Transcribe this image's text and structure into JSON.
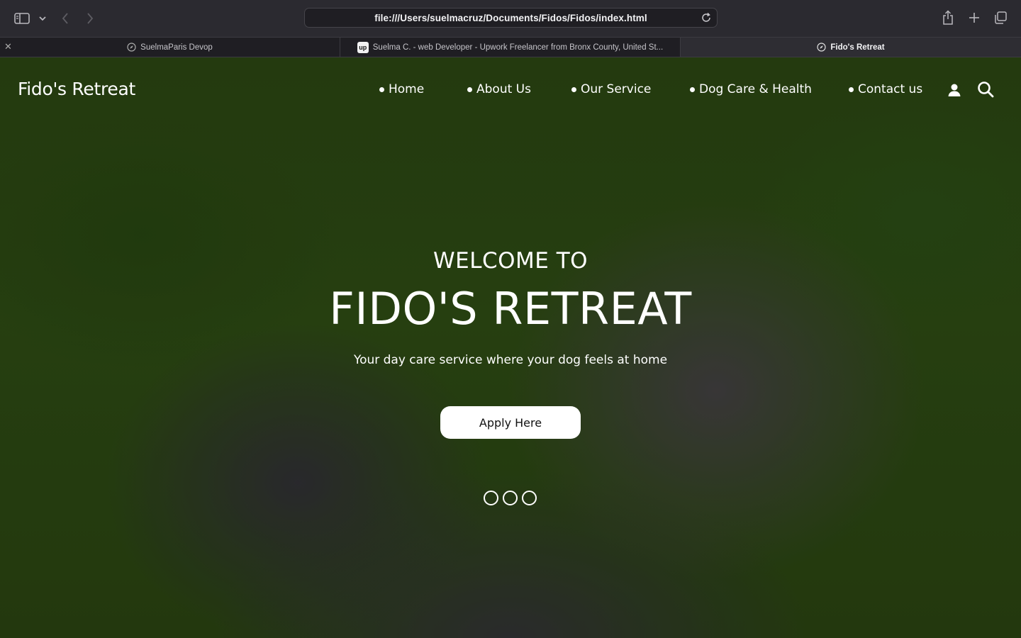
{
  "browser": {
    "address": "file:///Users/suelmacruz/Documents/Fidos/Fidos/index.html",
    "tabs": [
      {
        "title": "SuelmaParis Devop",
        "icon": "compass-icon",
        "active": false
      },
      {
        "title": "Suelma C. - web Developer - Upwork Freelancer from Bronx County, United St...",
        "icon": "upwork-icon",
        "active": false
      },
      {
        "title": "Fido's Retreat",
        "icon": "compass-icon",
        "active": true
      }
    ],
    "upwork_glyph": "up"
  },
  "site": {
    "logo": "Fido's Retreat",
    "nav": [
      {
        "label": "Home"
      },
      {
        "label": "About Us"
      },
      {
        "label": "Our Service"
      },
      {
        "label": "Dog Care & Health"
      },
      {
        "label": "Contact us"
      }
    ],
    "icons": [
      "user-icon",
      "search-icon"
    ]
  },
  "hero": {
    "welcome": "WELCOME TO",
    "title": "FIDO'S RETREAT",
    "tagline": "Your day care service where your dog feels at home",
    "cta": "Apply Here",
    "slide_count": 3
  },
  "colors": {
    "chrome_bg": "#2b2a30",
    "tabbar_bg": "#1f1e23",
    "hero_green": "#2f4d14",
    "text": "#ffffff"
  }
}
